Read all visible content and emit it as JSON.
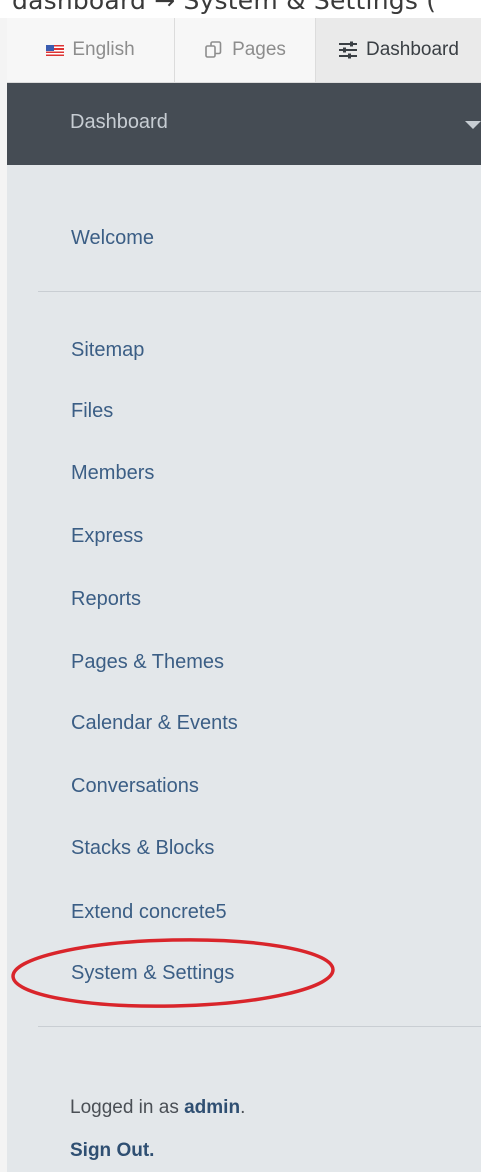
{
  "caption": "dashboard → System & Settings (",
  "toolbar": {
    "language_label": "English",
    "pages_label": "Pages",
    "dashboard_label": "Dashboard"
  },
  "dashboard_header": {
    "title": "Dashboard"
  },
  "nav": {
    "welcome": "Welcome",
    "items": [
      "Sitemap",
      "Files",
      "Members",
      "Express",
      "Reports",
      "Pages & Themes",
      "Calendar & Events",
      "Conversations",
      "Stacks & Blocks",
      "Extend concrete5",
      "System & Settings"
    ]
  },
  "account": {
    "logged_in_prefix": "Logged in as",
    "username": "admin",
    "logged_in_suffix": ".",
    "sign_out": "Sign Out."
  },
  "colors": {
    "header_bg": "#454c54",
    "panel_bg": "#e3e7ea",
    "link": "#3b5e85",
    "highlight_ring": "#d9252b"
  }
}
